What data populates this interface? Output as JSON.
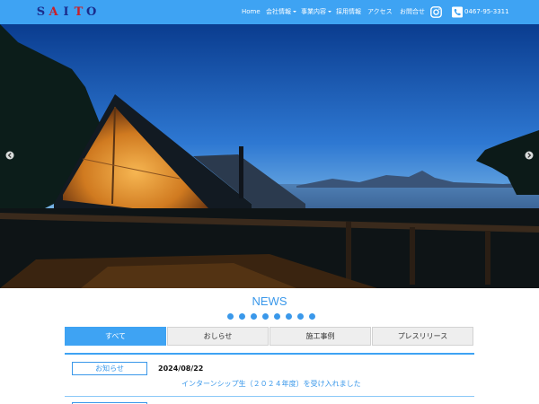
{
  "header": {
    "logo_letters": [
      "S",
      "A",
      "I",
      "T",
      "O"
    ],
    "logo_colors": [
      "#1a2d8c",
      "#c8202b",
      "#1a2d8c",
      "#c8202b",
      "#1a2d8c"
    ],
    "nav": [
      {
        "label": "Home",
        "dropdown": false
      },
      {
        "label": "会社情報",
        "dropdown": true
      },
      {
        "label": "事業内容",
        "dropdown": true
      },
      {
        "label": "採用情報",
        "dropdown": false
      },
      {
        "label": "アクセス",
        "dropdown": false
      },
      {
        "label": "お問合せ",
        "dropdown": false
      }
    ],
    "instagram_icon": "instagram-icon",
    "phone_icon": "phone-icon",
    "phone_number": "0467-95-3311"
  },
  "news": {
    "title": "NEWS",
    "tabs": [
      {
        "label": "すべて",
        "active": true
      },
      {
        "label": "おしらせ",
        "active": false
      },
      {
        "label": "施工事例",
        "active": false
      },
      {
        "label": "プレスリリース",
        "active": false
      }
    ],
    "items": [
      {
        "category": "お知らせ",
        "date": "2024/08/22",
        "title": "インターンシップ生（２０２４年度）を受け入れました"
      }
    ]
  },
  "colors": {
    "header_bg": "#3ea3f3",
    "accent": "#3a98ea"
  }
}
